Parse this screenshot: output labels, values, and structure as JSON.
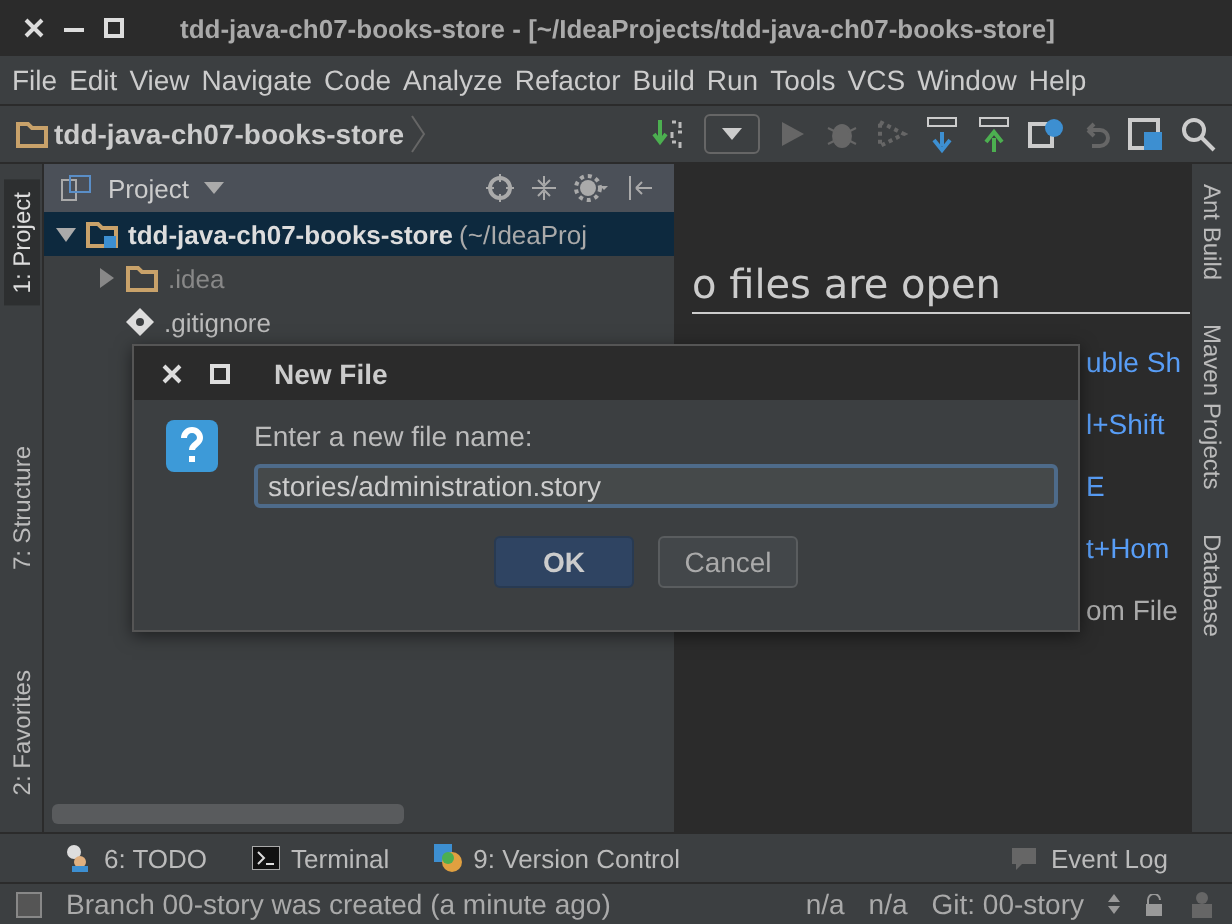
{
  "window": {
    "title": "tdd-java-ch07-books-store - [~/IdeaProjects/tdd-java-ch07-books-store]"
  },
  "menu": [
    "File",
    "Edit",
    "View",
    "Navigate",
    "Code",
    "Analyze",
    "Refactor",
    "Build",
    "Run",
    "Tools",
    "VCS",
    "Window",
    "Help"
  ],
  "breadcrumb": {
    "label": "tdd-java-ch07-books-store"
  },
  "left_tabs": [
    {
      "label": "1: Project",
      "selected": true
    },
    {
      "label": "7: Structure",
      "selected": false
    },
    {
      "label": "2: Favorites",
      "selected": false
    }
  ],
  "project_panel": {
    "title": "Project",
    "tree": [
      {
        "name": "tdd-java-ch07-books-store",
        "path": "(~/IdeaProj",
        "kind": "module",
        "expanded": true,
        "selected": true,
        "children": [
          {
            "name": ".idea",
            "kind": "folder",
            "expanded": false,
            "selected": false
          },
          {
            "name": ".gitignore",
            "kind": "file",
            "selected": false
          }
        ]
      }
    ]
  },
  "editor": {
    "heading": "o files are open",
    "hints": [
      {
        "text": "uble Sh",
        "kind": "shortcut"
      },
      {
        "text": "l+Shift",
        "kind": "shortcut"
      },
      {
        "text": "E",
        "kind": "shortcut"
      },
      {
        "text": "t+Hom",
        "kind": "shortcut"
      },
      {
        "text": "om File",
        "kind": "plain"
      }
    ]
  },
  "right_tabs": [
    "Ant Build",
    "Maven Projects",
    "Database"
  ],
  "dialog": {
    "title": "New File",
    "prompt": "Enter a new file name:",
    "value": "stories/administration.story",
    "buttons": [
      {
        "label": "OK",
        "default": true
      },
      {
        "label": "Cancel",
        "default": false
      }
    ]
  },
  "tool_tabs": [
    "6: TODO",
    "Terminal",
    "9: Version Control"
  ],
  "event_log": "Event Log",
  "status_bar": {
    "message": "Branch 00-story was created (a minute ago)",
    "fields": [
      "n/a",
      "n/a",
      "Git: 00-story"
    ]
  }
}
